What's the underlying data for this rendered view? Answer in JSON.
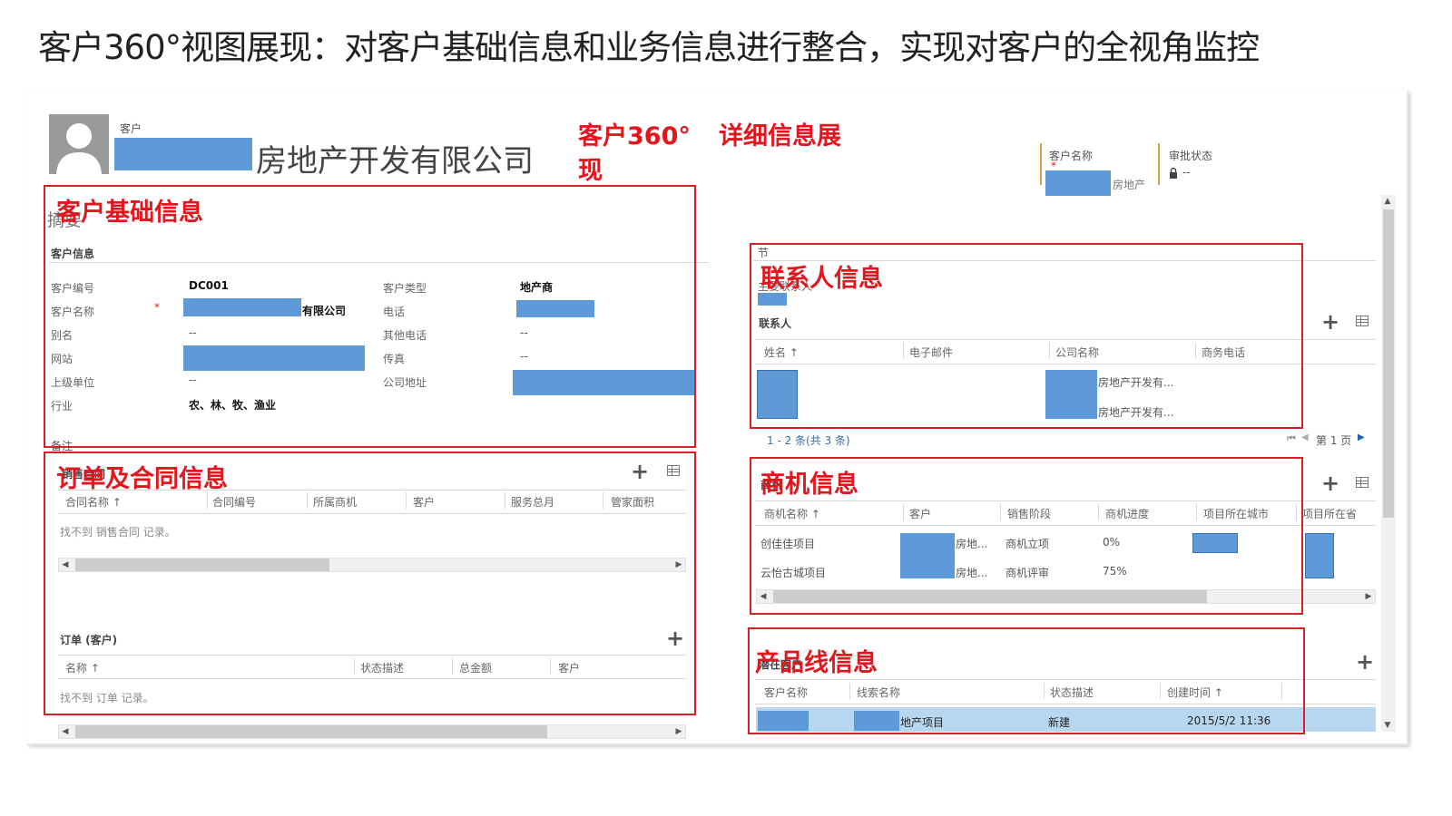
{
  "slide": {
    "title": "客户360°视图展现：对客户基础信息和业务信息进行整合，实现对客户的全视角监控"
  },
  "annotations": {
    "c360": "客户360°",
    "detail": "详细信息展",
    "detail2": "现",
    "basic": "客户基础信息",
    "orders": "订单及合同信息",
    "contacts": "联系人信息",
    "opps": "商机信息",
    "products": "产品线信息"
  },
  "header": {
    "entity_type": "客户",
    "name_suffix": "房地产开发有限公司",
    "right_name_label": "客户名称",
    "right_name_partial": "房地产",
    "approval_label": "审批状态",
    "approval_value": "--"
  },
  "summary": {
    "tab": "摘要",
    "section": "客户信息",
    "fields_left": [
      {
        "label": "客户编号",
        "value": "DC001"
      },
      {
        "label": "客户名称",
        "value": "有限公司",
        "required": "*"
      },
      {
        "label": "别名",
        "value": "--"
      },
      {
        "label": "网站",
        "value": ""
      },
      {
        "label": "上级单位",
        "value": "--"
      },
      {
        "label": "行业",
        "value": "农、林、牧、渔业"
      }
    ],
    "fields_right": [
      {
        "label": "客户类型",
        "value": "地产商"
      },
      {
        "label": "电话",
        "value": ""
      },
      {
        "label": "其他电话",
        "value": "--"
      },
      {
        "label": "传真",
        "value": "--"
      },
      {
        "label": "公司地址",
        "value": ""
      }
    ],
    "notes_label": "备注"
  },
  "contracts": {
    "title": "销售合同",
    "columns": [
      "合同名称 ↑",
      "合同编号",
      "所属商机",
      "客户",
      "服务总月",
      "管家面积"
    ],
    "empty": "找不到 销售合同 记录。"
  },
  "orders": {
    "title": "订单 (客户)",
    "columns": [
      "名称 ↑",
      "状态描述",
      "总金额",
      "客户"
    ],
    "empty": "找不到 订单 记录。"
  },
  "contacts": {
    "section": "节",
    "primary": "主要联系人",
    "title": "联系人",
    "columns": [
      "姓名 ↑",
      "电子邮件",
      "公司名称",
      "商务电话"
    ],
    "rows": [
      {
        "company": "房地产开发有..."
      },
      {
        "company": "房地产开发有..."
      }
    ],
    "pager": "1 - 2 条(共 3 条)",
    "page": "第 1 页"
  },
  "opportunities": {
    "title": "商机",
    "columns": [
      "商机名称 ↑",
      "客户",
      "销售阶段",
      "商机进度",
      "项目所在城市",
      "项目所在省"
    ],
    "rows": [
      {
        "name": "创佳佳项目",
        "customer": "房地...",
        "stage": "商机立项",
        "progress": "0%"
      },
      {
        "name": "云怡古城项目",
        "customer": "房地...",
        "stage": "商机评审",
        "progress": "75%"
      }
    ]
  },
  "products": {
    "title": "潜在客户",
    "columns": [
      "客户名称",
      "线索名称",
      "状态描述",
      "创建时间 ↑"
    ],
    "rows": [
      {
        "lead": "地产项目",
        "status": "新建",
        "created": "2015/5/2 11:36"
      }
    ]
  },
  "colors": {
    "annotation_red": "#e3161e",
    "redact_blue": "#5e9ad7",
    "selected_row": "#b7d7f0"
  }
}
